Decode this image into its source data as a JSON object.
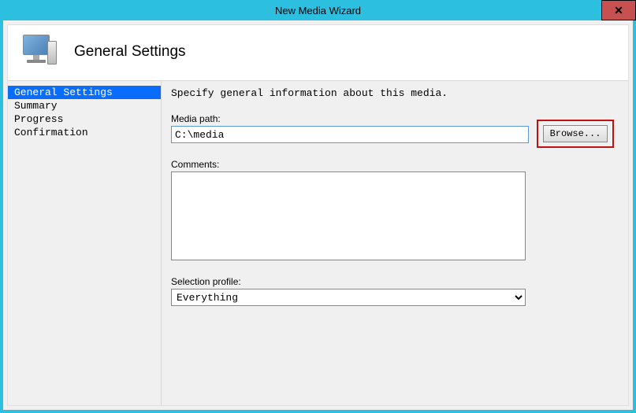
{
  "window": {
    "title": "New Media Wizard",
    "close_glyph": "✕"
  },
  "header": {
    "title": "General Settings",
    "icon": "computer-icon"
  },
  "sidebar": {
    "items": [
      {
        "label": "General Settings",
        "selected": true
      },
      {
        "label": "Summary",
        "selected": false
      },
      {
        "label": "Progress",
        "selected": false
      },
      {
        "label": "Confirmation",
        "selected": false
      }
    ]
  },
  "main": {
    "instruction": "Specify general information about this media.",
    "media_path_label": "Media path:",
    "media_path_value": "C:\\media",
    "browse_label": "Browse...",
    "comments_label": "Comments:",
    "comments_value": "",
    "selection_profile_label": "Selection profile:",
    "selection_profile_value": "Everything"
  }
}
